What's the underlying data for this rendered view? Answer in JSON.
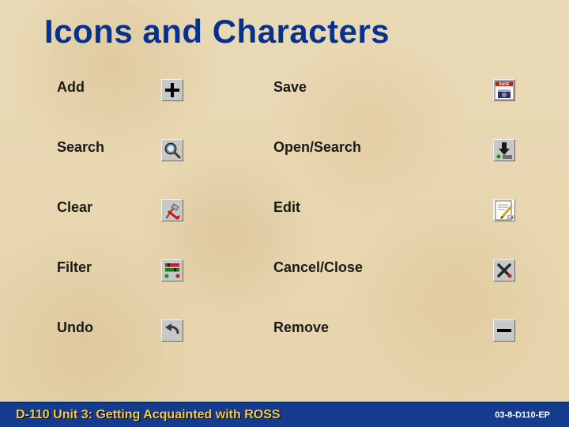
{
  "title": "Icons and Characters",
  "rows": [
    {
      "left_label": "Add",
      "right_label": "Save"
    },
    {
      "left_label": "Search",
      "right_label": "Open/Search"
    },
    {
      "left_label": "Clear",
      "right_label": "Edit"
    },
    {
      "left_label": "Filter",
      "right_label": "Cancel/Close"
    },
    {
      "left_label": "Undo",
      "right_label": "Remove"
    }
  ],
  "footer": {
    "unit": "D-110 Unit 3: Getting Acquainted with ROSS",
    "code": "03-8-D110-EP"
  }
}
